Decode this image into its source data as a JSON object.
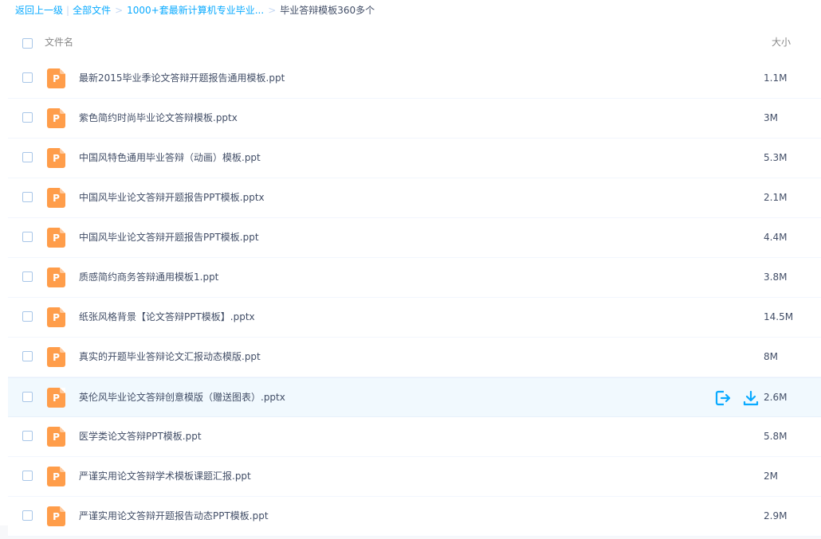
{
  "breadcrumb": {
    "back": "返回上一级",
    "all_files": "全部文件",
    "folder": "1000+套最新计算机专业毕业...",
    "current": "毕业答辩模板360多个"
  },
  "header": {
    "name_col": "文件名",
    "size_col": "大小"
  },
  "file_icon_letter": "P",
  "accent_color": "#09aaff",
  "file_icon_color": "#ff9d4a",
  "hovered_row_index": 8,
  "files": [
    {
      "name": "最新2015毕业季论文答辩开题报告通用模板.ppt",
      "size": "1.1M"
    },
    {
      "name": "紫色简约时尚毕业论文答辩模板.pptx",
      "size": "3M"
    },
    {
      "name": "中国风特色通用毕业答辩（动画）模板.ppt",
      "size": "5.3M"
    },
    {
      "name": "中国风毕业论文答辩开题报告PPT模板.pptx",
      "size": "2.1M"
    },
    {
      "name": "中国风毕业论文答辩开题报告PPT模板.ppt",
      "size": "4.4M"
    },
    {
      "name": "质感简约商务答辩通用模板1.ppt",
      "size": "3.8M"
    },
    {
      "name": "纸张风格背景【论文答辩PPT模板】.pptx",
      "size": "14.5M"
    },
    {
      "name": "真实的开题毕业答辩论文汇报动态模版.ppt",
      "size": "8M"
    },
    {
      "name": "英伦风毕业论文答辩创意模版（赠送图表）.pptx",
      "size": "2.6M"
    },
    {
      "name": "医学类论文答辩PPT模板.ppt",
      "size": "5.8M"
    },
    {
      "name": "严谨实用论文答辩学术模板课题汇报.ppt",
      "size": "2M"
    },
    {
      "name": "严谨实用论文答辩开题报告动态PPT模板.ppt",
      "size": "2.9M"
    }
  ]
}
